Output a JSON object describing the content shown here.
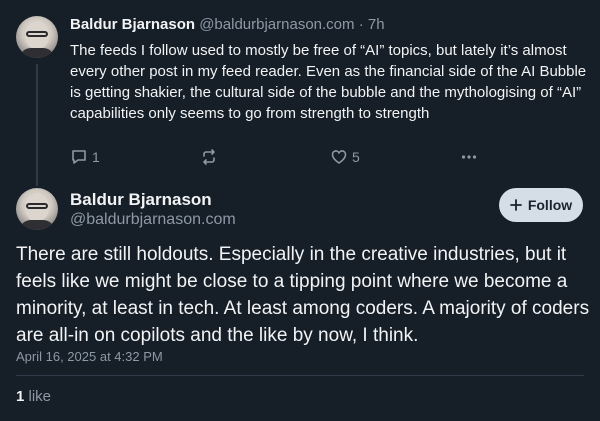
{
  "reply": {
    "author_name": "Baldur Bjarnason",
    "author_handle": "@baldurbjarnason.com",
    "separator": "·",
    "time_ago": "7h",
    "text": "The feeds I follow used to mostly be free of “AI” topics, but lately it’s almost every other post in my feed reader. Even as the financial side of the AI Bubble is getting shakier, the cultural side of the bubble and the mythologising of “AI” capabilities only seems to go from strength to strength",
    "reply_count": "1",
    "like_count": "5"
  },
  "main_post": {
    "author_name": "Baldur Bjarnason",
    "author_handle": "@baldurbjarnason.com",
    "follow_label": "Follow",
    "text": "There are still holdouts. Especially in the creative industries, but it feels like we might be close to a tipping point where we become a minority, at least in tech. At least among coders. A majority of coders are all-in on copilots and the like by now, I think.",
    "timestamp": "April 16, 2025 at 4:32 PM",
    "likes_count": "1",
    "likes_label": "like"
  },
  "icons": {
    "reply": "speech-bubble-icon",
    "repost": "repost-arrows-icon",
    "like": "heart-icon",
    "more": "ellipsis-icon",
    "follow": "plus-icon"
  },
  "colors": {
    "background": "#161e27",
    "text": "#f1f3f5",
    "muted": "#8d99a6",
    "follow_button": "#d5dde6"
  }
}
